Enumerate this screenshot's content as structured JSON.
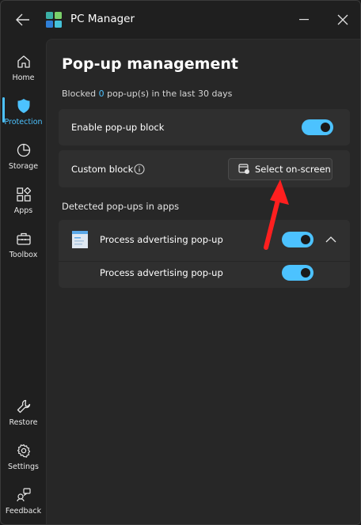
{
  "window": {
    "title": "PC Manager"
  },
  "sidebar": {
    "items": [
      {
        "label": "Home",
        "icon": "home-icon"
      },
      {
        "label": "Protection",
        "icon": "shield-icon",
        "active": true
      },
      {
        "label": "Storage",
        "icon": "pie-chart-icon"
      },
      {
        "label": "Apps",
        "icon": "apps-grid-icon"
      },
      {
        "label": "Toolbox",
        "icon": "toolbox-icon"
      },
      {
        "label": "Restore",
        "icon": "wrench-icon"
      },
      {
        "label": "Settings",
        "icon": "gear-icon"
      },
      {
        "label": "Feedback",
        "icon": "feedback-icon"
      }
    ]
  },
  "main": {
    "title": "Pop-up management",
    "blocked_prefix": "Blocked ",
    "blocked_count": "0",
    "blocked_suffix": " pop-up(s) in the last 30 days",
    "enable_block": {
      "label": "Enable pop-up block",
      "on": true
    },
    "custom_block": {
      "label": "Custom block",
      "button_label": "Select on-screen"
    },
    "detected_heading": "Detected pop-ups in apps",
    "detected": {
      "app_label": "Process advertising pop-up",
      "app_toggle_on": true,
      "expanded": true,
      "sub_label": "Process advertising pop-up",
      "sub_toggle_on": true
    }
  },
  "colors": {
    "accent": "#4cc2ff",
    "annotation_arrow": "#ff1f1f",
    "background": "#1f1f1f",
    "card": "#2f2f2f"
  }
}
